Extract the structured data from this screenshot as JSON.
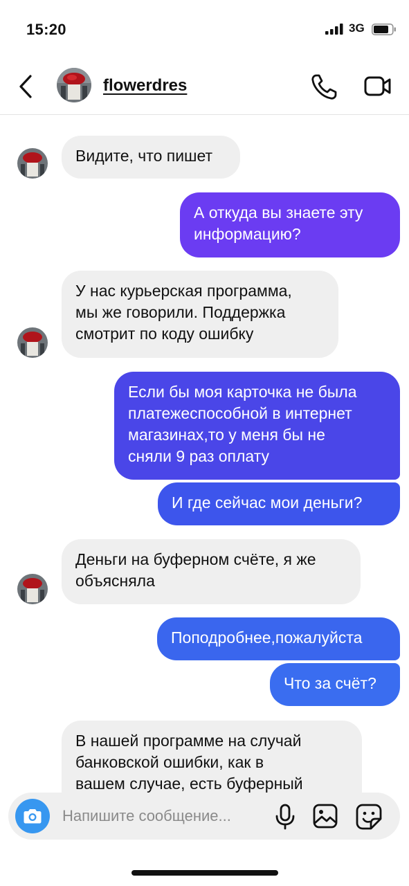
{
  "status_bar": {
    "time": "15:20",
    "network": "3G"
  },
  "header": {
    "username": "flowerdres"
  },
  "messages": [
    {
      "side": "in",
      "lines": [
        "Видите, что пишет"
      ]
    },
    {
      "side": "out",
      "lines": [
        "А откуда вы знаете эту",
        "информацию?"
      ],
      "color": "#6b3cf2"
    },
    {
      "side": "in",
      "lines": [
        "У нас курьерская программа,",
        "мы же говорили. Поддержка",
        "смотрит по коду ошибку"
      ]
    },
    {
      "side": "out",
      "lines": [
        "Если бы моя карточка не была",
        "платежеспособной в интернет",
        "магазинах,то у меня бы не",
        "сняли 9 раз оплату"
      ],
      "color": "#4a46e8"
    },
    {
      "side": "out",
      "lines": [
        "И где сейчас мои деньги?"
      ],
      "color": "#3d55ec"
    },
    {
      "side": "in",
      "lines": [
        "Деньги на буферном счёте, я же",
        "объясняла"
      ]
    },
    {
      "side": "out",
      "lines": [
        "Поподробнее,пожалуйста"
      ],
      "color": "#3a66ee"
    },
    {
      "side": "out",
      "lines": [
        "Что за счёт?"
      ],
      "color": "#3a6df0"
    },
    {
      "side": "in",
      "lines": [
        "В нашей программе на случай",
        "банковской ошибки, как в",
        "вашем случае, есть буферный"
      ]
    }
  ],
  "input": {
    "placeholder": "Напишите сообщение..."
  },
  "icons": {
    "back": "chevron-left-icon",
    "call": "phone-icon",
    "video": "video-camera-icon",
    "camera": "camera-icon",
    "mic": "microphone-icon",
    "gallery": "image-icon",
    "sticker": "sticker-icon"
  }
}
